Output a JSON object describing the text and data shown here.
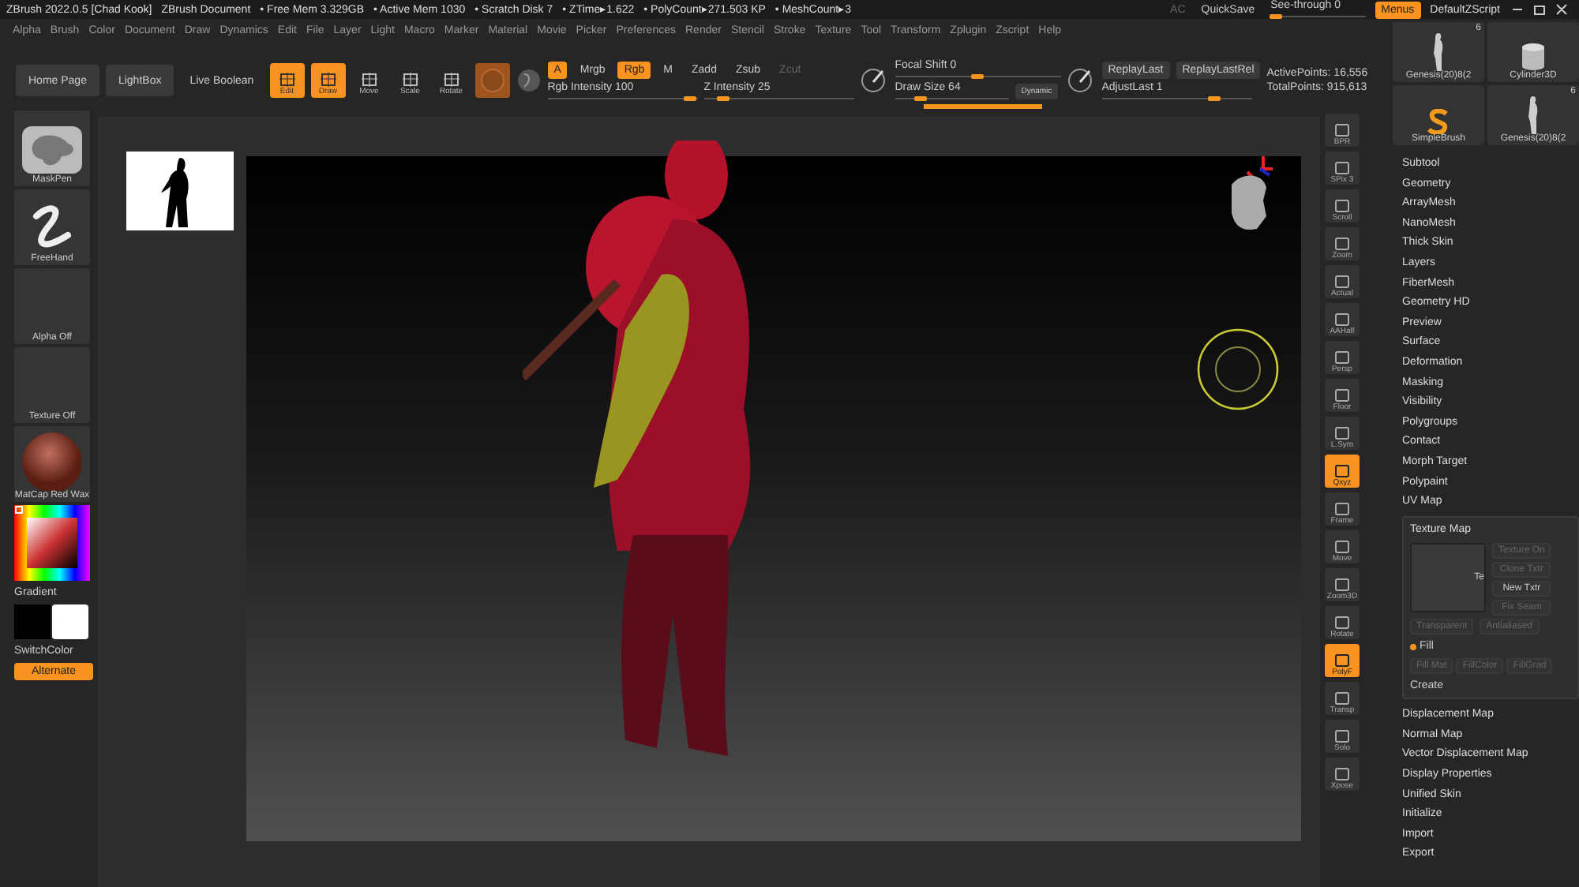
{
  "title_bar": {
    "app": "ZBrush 2022.0.5 [Chad Kook]",
    "document": "ZBrush Document",
    "stats": [
      "• Free Mem 3.329GB",
      "• Active Mem 1030",
      "• Scratch Disk 7",
      "• ZTime▸1.622",
      "• PolyCount▸271.503 KP",
      "• MeshCount▸3"
    ],
    "ac": "AC",
    "quicksave": "QuickSave",
    "see_through": {
      "label": "See-through  0",
      "level": 0.05
    },
    "menus": {
      "label": "Menus",
      "selected": true
    },
    "script": "DefaultZScript"
  },
  "menu": [
    "Alpha",
    "Brush",
    "Color",
    "Document",
    "Draw",
    "Dynamics",
    "Edit",
    "File",
    "Layer",
    "Light",
    "Macro",
    "Marker",
    "Material",
    "Movie",
    "Picker",
    "Preferences",
    "Render",
    "Stencil",
    "Stroke",
    "Texture",
    "Tool",
    "Transform",
    "Zplugin",
    "Zscript",
    "Help"
  ],
  "toolbar": {
    "home_page": "Home Page",
    "lightbox": "LightBox",
    "live_boolean": "Live Boolean",
    "tools": [
      {
        "label": "Edit",
        "selected": true
      },
      {
        "label": "Draw",
        "selected": true
      },
      {
        "label": "Move",
        "selected": false
      },
      {
        "label": "Scale",
        "selected": false
      },
      {
        "label": "Rotate",
        "selected": false
      }
    ],
    "modes": [
      {
        "label": "A",
        "selected": true
      },
      {
        "label": "Mrgb",
        "selected": false
      },
      {
        "label": "Rgb",
        "selected": true
      },
      {
        "label": "M",
        "selected": false
      },
      {
        "label": "Zadd",
        "selected": false
      },
      {
        "label": "Zsub",
        "selected": false
      },
      {
        "label": "Zcut",
        "selected": false
      }
    ],
    "sliders_a": [
      {
        "label": "Rgb Intensity 100",
        "level": 0.95
      },
      {
        "label": "Z Intensity 25",
        "level": 0.13
      }
    ],
    "focal_shift": {
      "label": "Focal Shift 0",
      "level": 0.5
    },
    "draw_size": {
      "label": "Draw Size 64",
      "level": 0.22
    },
    "dynamic": "Dynamic",
    "replay_last": "ReplayLast",
    "replay_last_rel": "ReplayLastRel",
    "adjust_last": {
      "label": "AdjustLast 1",
      "level": 0.75
    },
    "active_points": "ActivePoints: 16,556",
    "total_points": "TotalPoints: 915,613"
  },
  "left_panel": {
    "tiles": [
      {
        "kind": "brush",
        "label": "MaskPen"
      },
      {
        "kind": "stroke",
        "label": "FreeHand"
      },
      {
        "kind": "empty",
        "label": "Alpha Off"
      },
      {
        "kind": "empty",
        "label": "Texture Off"
      },
      {
        "kind": "material",
        "label": "MatCap Red Wax"
      }
    ],
    "gradient": "Gradient",
    "switch_color": "SwitchColor",
    "alternate": "Alternate"
  },
  "view_controls": [
    {
      "label": "BPR",
      "selected": false
    },
    {
      "label": "SPix 3",
      "selected": false
    },
    {
      "label": "Scroll",
      "selected": false
    },
    {
      "label": "Zoom",
      "selected": false
    },
    {
      "label": "Actual",
      "selected": false
    },
    {
      "label": "AAHalf",
      "selected": false
    },
    {
      "label": "Persp",
      "selected": false
    },
    {
      "label": "Floor",
      "selected": false
    },
    {
      "label": "L.Sym",
      "selected": false
    },
    {
      "label": "Qxyz",
      "selected": true
    },
    {
      "label": "Frame",
      "selected": false
    },
    {
      "label": "Move",
      "selected": false
    },
    {
      "label": "Zoom3D",
      "selected": false
    },
    {
      "label": "Rotate",
      "selected": false
    },
    {
      "label": "PolyF",
      "selected": true
    },
    {
      "label": "Transp",
      "selected": false
    },
    {
      "label": "Solo",
      "selected": false
    },
    {
      "label": "Xpose",
      "selected": false
    }
  ],
  "tool_thumbs": [
    {
      "kind": "figure",
      "label": "Genesis(20)8(2",
      "count": "6"
    },
    {
      "kind": "cylinder",
      "label": "Cylinder3D"
    },
    {
      "kind": "brush",
      "label": "SimpleBrush"
    },
    {
      "kind": "figure",
      "label": "Genesis(20)8(2",
      "count": "6"
    }
  ],
  "tool_menu": [
    "Subtool",
    "Geometry",
    "ArrayMesh",
    "NanoMesh",
    "Thick Skin",
    "Layers",
    "FiberMesh",
    "Geometry HD",
    "Preview",
    "Surface",
    "Deformation",
    "Masking",
    "Visibility",
    "Polygroups",
    "Contact",
    "Morph Target",
    "Polypaint",
    "UV Map"
  ],
  "texture_map": {
    "title": "Texture Map",
    "preview_label": "Te",
    "buttons": [
      {
        "label": "Texture On",
        "disabled": true
      },
      {
        "label": "Clone Txtr",
        "disabled": true
      },
      {
        "label": "New Txtr",
        "disabled": false
      },
      {
        "label": "Fix Seam",
        "disabled": true
      }
    ],
    "transparent": {
      "label": "Transparent",
      "disabled": true
    },
    "antialiased": {
      "label": "Antialiased",
      "disabled": true
    },
    "fill": "Fill",
    "fill_buttons": [
      {
        "label": "Fill Mat",
        "disabled": true
      },
      {
        "label": "FillColor",
        "disabled": true
      },
      {
        "label": "FillGrad",
        "disabled": true
      }
    ],
    "create": "Create"
  },
  "tool_menu_after": [
    "Displacement Map",
    "Normal Map",
    "Vector Displacement Map",
    "Display Properties",
    "Unified Skin",
    "Initialize",
    "Import",
    "Export"
  ]
}
